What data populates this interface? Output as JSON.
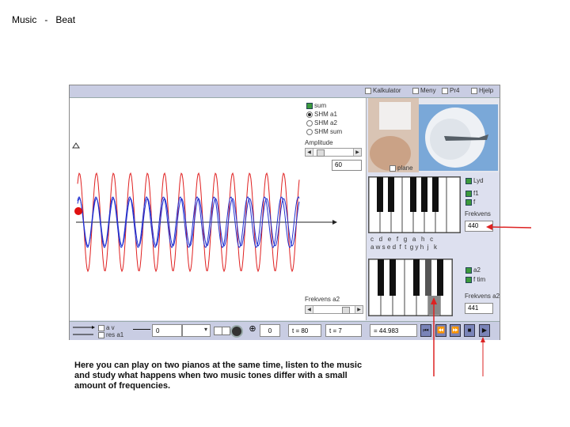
{
  "page": {
    "title_left": "Music",
    "title_sep": "-",
    "title_right": "Beat",
    "caption": "Here you can play on two pianos at the same time, listen to the music and study what happens when two music tones differ with a small amount of frequencies."
  },
  "topbar": {
    "items": [
      "Kalkulator",
      "Meny",
      "Pr4",
      "Hjelp"
    ]
  },
  "options": {
    "sum_label": "sum",
    "radios": [
      "SHM a1",
      "SHM a2",
      "SHM sum"
    ],
    "selected_radio": 0,
    "amplitude_label": "Amplitude",
    "amplitude_value": "60",
    "plane_label": "plane"
  },
  "piano1": {
    "checks": [
      "Lyd",
      "f1",
      "f"
    ],
    "freq_label": "Frekvens",
    "freq_value": "440",
    "note_row": "c   d   e   f   g   a   h   c",
    "key_row": "a w s e d  f  t  g y h  j   k"
  },
  "piano2": {
    "checks": [
      "a2",
      "f tim"
    ],
    "freq_label": "Frekvens a2",
    "freq_value": "441"
  },
  "bottombar": {
    "legend": [
      "a v",
      "res a1"
    ],
    "field_value": "0",
    "counter_value": "0",
    "t1": "t = 80",
    "t2": "t = 7",
    "t3": "= 44.983",
    "transport": [
      "prev-fast",
      "prev",
      "next",
      "stop",
      "play"
    ]
  },
  "colors": {
    "wave_red": "#e02020",
    "wave_blue": "#2030d0",
    "annotation_red": "#dd2222",
    "app_bg": "#dde0ef",
    "bar_bg": "#c9cde3"
  }
}
